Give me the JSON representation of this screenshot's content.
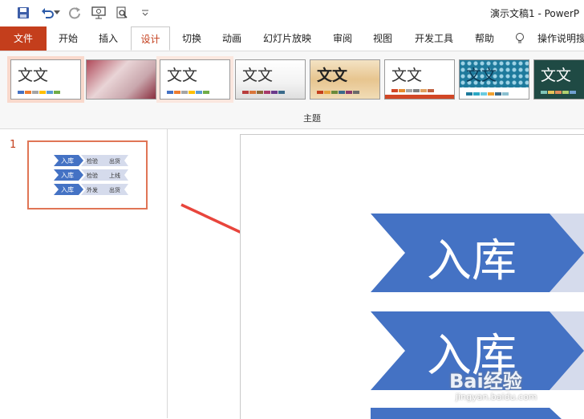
{
  "window": {
    "title": "演示文稿1  -  PowerP"
  },
  "tabs": [
    {
      "label": "文件"
    },
    {
      "label": "开始"
    },
    {
      "label": "插入"
    },
    {
      "label": "设计"
    },
    {
      "label": "切换"
    },
    {
      "label": "动画"
    },
    {
      "label": "幻灯片放映"
    },
    {
      "label": "审阅"
    },
    {
      "label": "视图"
    },
    {
      "label": "开发工具"
    },
    {
      "label": "帮助"
    },
    {
      "label": "操作说明搜"
    }
  ],
  "ribbon": {
    "group_label": "主题",
    "themes": [
      {
        "text": "文文"
      },
      {
        "text": ""
      },
      {
        "text": "文文"
      },
      {
        "text": "文文"
      },
      {
        "text": "文文"
      },
      {
        "text": "文文"
      },
      {
        "text": "文文"
      },
      {
        "text": "文文"
      }
    ]
  },
  "slides_panel": {
    "slide_number": "1",
    "thumb_rows": [
      {
        "head": "入库",
        "a": "检验",
        "b": "出货"
      },
      {
        "head": "入库",
        "a": "检验",
        "b": "上线"
      },
      {
        "head": "入库",
        "a": "外发",
        "b": "出货"
      }
    ]
  },
  "slide": {
    "rows": [
      {
        "head": "入库"
      },
      {
        "head": "入库"
      }
    ]
  },
  "watermark": {
    "text": "Bai经验",
    "url": "jingyan.baidu.com"
  },
  "colors": {
    "accent": "#c43e1c",
    "chevron": "#4472c4",
    "chevron_light": "#d5dbec",
    "arrow": "#e8453c"
  }
}
